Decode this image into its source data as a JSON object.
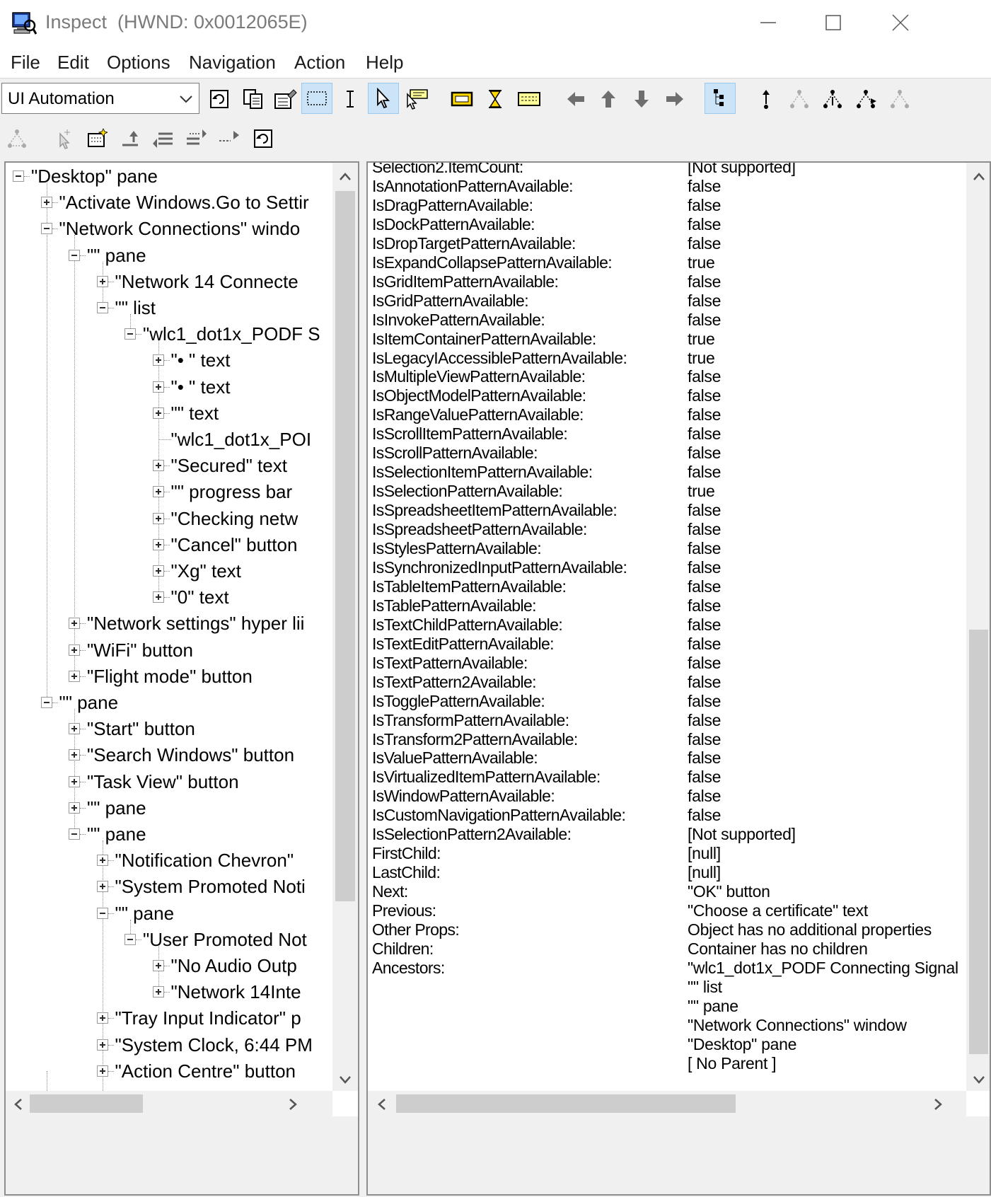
{
  "window": {
    "title": "Inspect  (HWND: 0x0012065E)"
  },
  "menu": [
    "File",
    "Edit",
    "Options",
    "Navigation",
    "Action",
    "Help"
  ],
  "toolbar": {
    "mode_select": "UI Automation"
  },
  "tree": [
    {
      "label": "\"Desktop\" pane",
      "depth": 0,
      "exp": "minus"
    },
    {
      "label": "\"Activate Windows.Go to Settir",
      "depth": 1,
      "exp": "plus"
    },
    {
      "label": "\"Network Connections\" windo",
      "depth": 1,
      "exp": "minus"
    },
    {
      "label": "\"\" pane",
      "depth": 2,
      "exp": "minus"
    },
    {
      "label": "\"Network  14 Connecte",
      "depth": 3,
      "exp": "plus"
    },
    {
      "label": "\"\" list",
      "depth": 3,
      "exp": "minus"
    },
    {
      "label": "\"wlc1_dot1x_PODF S",
      "depth": 4,
      "exp": "minus"
    },
    {
      "label": "\"• \" text",
      "depth": 5,
      "exp": "plus"
    },
    {
      "label": "\"• \" text",
      "depth": 5,
      "exp": "plus"
    },
    {
      "label": "\"\" text",
      "depth": 5,
      "exp": "plus"
    },
    {
      "label": "\"wlc1_dot1x_POI",
      "depth": 5,
      "exp": "none"
    },
    {
      "label": "\"Secured\" text",
      "depth": 5,
      "exp": "plus"
    },
    {
      "label": "\"\" progress bar",
      "depth": 5,
      "exp": "plus"
    },
    {
      "label": "\"Checking netw",
      "depth": 5,
      "exp": "plus"
    },
    {
      "label": "\"Cancel\" button",
      "depth": 5,
      "exp": "plus"
    },
    {
      "label": "\"Xg\" text",
      "depth": 5,
      "exp": "plus"
    },
    {
      "label": "\"0\" text",
      "depth": 5,
      "exp": "plus"
    },
    {
      "label": "\"Network settings\" hyper lii",
      "depth": 2,
      "exp": "plus"
    },
    {
      "label": "\"WiFi\" button",
      "depth": 2,
      "exp": "plus"
    },
    {
      "label": "\"Flight mode\" button",
      "depth": 2,
      "exp": "plus"
    },
    {
      "label": "\"\" pane",
      "depth": 1,
      "exp": "minus"
    },
    {
      "label": "\"Start\" button",
      "depth": 2,
      "exp": "plus"
    },
    {
      "label": "\"Search Windows\" button",
      "depth": 2,
      "exp": "plus"
    },
    {
      "label": "\"Task View\" button",
      "depth": 2,
      "exp": "plus"
    },
    {
      "label": "\"\" pane",
      "depth": 2,
      "exp": "plus"
    },
    {
      "label": "\"\" pane",
      "depth": 2,
      "exp": "minus"
    },
    {
      "label": "\"Notification Chevron\"",
      "depth": 3,
      "exp": "plus"
    },
    {
      "label": "\"System Promoted Noti",
      "depth": 3,
      "exp": "plus"
    },
    {
      "label": "\"\" pane",
      "depth": 3,
      "exp": "minus"
    },
    {
      "label": "\"User Promoted Not",
      "depth": 4,
      "exp": "minus"
    },
    {
      "label": "\"No Audio Outp",
      "depth": 5,
      "exp": "plus"
    },
    {
      "label": "\"Network  14Inte",
      "depth": 5,
      "exp": "plus"
    },
    {
      "label": "\"Tray Input Indicator\" p",
      "depth": 3,
      "exp": "plus"
    },
    {
      "label": "\"System Clock, 6:44 PM",
      "depth": 3,
      "exp": "plus"
    },
    {
      "label": "\"Action Centre\" button",
      "depth": 3,
      "exp": "plus"
    }
  ],
  "properties": [
    {
      "name": "Selection2.ItemCount:",
      "value": "[Not supported]"
    },
    {
      "name": "IsAnnotationPatternAvailable:",
      "value": "false"
    },
    {
      "name": "IsDragPatternAvailable:",
      "value": "false"
    },
    {
      "name": "IsDockPatternAvailable:",
      "value": "false"
    },
    {
      "name": "IsDropTargetPatternAvailable:",
      "value": "false"
    },
    {
      "name": "IsExpandCollapsePatternAvailable:",
      "value": "true"
    },
    {
      "name": "IsGridItemPatternAvailable:",
      "value": "false"
    },
    {
      "name": "IsGridPatternAvailable:",
      "value": "false"
    },
    {
      "name": "IsInvokePatternAvailable:",
      "value": "false"
    },
    {
      "name": "IsItemContainerPatternAvailable:",
      "value": "true"
    },
    {
      "name": "IsLegacyIAccessiblePatternAvailable:",
      "value": "true"
    },
    {
      "name": "IsMultipleViewPatternAvailable:",
      "value": "false"
    },
    {
      "name": "IsObjectModelPatternAvailable:",
      "value": "false"
    },
    {
      "name": "IsRangeValuePatternAvailable:",
      "value": "false"
    },
    {
      "name": "IsScrollItemPatternAvailable:",
      "value": "false"
    },
    {
      "name": "IsScrollPatternAvailable:",
      "value": "false"
    },
    {
      "name": "IsSelectionItemPatternAvailable:",
      "value": "false"
    },
    {
      "name": "IsSelectionPatternAvailable:",
      "value": "true"
    },
    {
      "name": "IsSpreadsheetItemPatternAvailable:",
      "value": "false"
    },
    {
      "name": "IsSpreadsheetPatternAvailable:",
      "value": "false"
    },
    {
      "name": "IsStylesPatternAvailable:",
      "value": "false"
    },
    {
      "name": "IsSynchronizedInputPatternAvailable:",
      "value": "false"
    },
    {
      "name": "IsTableItemPatternAvailable:",
      "value": "false"
    },
    {
      "name": "IsTablePatternAvailable:",
      "value": "false"
    },
    {
      "name": "IsTextChildPatternAvailable:",
      "value": "false"
    },
    {
      "name": "IsTextEditPatternAvailable:",
      "value": "false"
    },
    {
      "name": "IsTextPatternAvailable:",
      "value": "false"
    },
    {
      "name": "IsTextPattern2Available:",
      "value": "false"
    },
    {
      "name": "IsTogglePatternAvailable:",
      "value": "false"
    },
    {
      "name": "IsTransformPatternAvailable:",
      "value": "false"
    },
    {
      "name": "IsTransform2PatternAvailable:",
      "value": "false"
    },
    {
      "name": "IsValuePatternAvailable:",
      "value": "false"
    },
    {
      "name": "IsVirtualizedItemPatternAvailable:",
      "value": "false"
    },
    {
      "name": "IsWindowPatternAvailable:",
      "value": "false"
    },
    {
      "name": "IsCustomNavigationPatternAvailable:",
      "value": "false"
    },
    {
      "name": "IsSelectionPattern2Available:",
      "value": "[Not supported]"
    },
    {
      "name": "FirstChild:",
      "value": "[null]"
    },
    {
      "name": "LastChild:",
      "value": "[null]"
    },
    {
      "name": "Next:",
      "value": "\"OK\" button"
    },
    {
      "name": "Previous:",
      "value": "\"Choose a certificate\" text"
    },
    {
      "name": "Other Props:",
      "value": "Object has no additional properties"
    },
    {
      "name": "Children:",
      "value": "Container has no children"
    },
    {
      "name": "Ancestors:",
      "value": "\"wlc1_dot1x_PODF Connecting Signal"
    },
    {
      "name": "",
      "value": "\"\" list"
    },
    {
      "name": "",
      "value": "\"\" pane"
    },
    {
      "name": "",
      "value": "\"Network Connections\" window"
    },
    {
      "name": "",
      "value": "\"Desktop\" pane"
    },
    {
      "name": "",
      "value": "[ No Parent ]"
    }
  ]
}
